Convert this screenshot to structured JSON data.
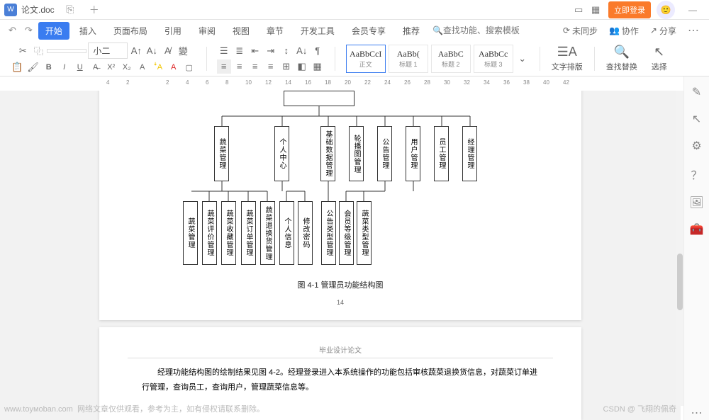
{
  "titlebar": {
    "filename": "论文.doc",
    "login": "立即登录",
    "avatar": "Hi"
  },
  "menubar": {
    "undo1": "↶",
    "redo": "↷",
    "items": [
      "开始",
      "插入",
      "页面布局",
      "引用",
      "审阅",
      "视图",
      "章节",
      "开发工具",
      "会员专享",
      "推荐"
    ],
    "search_placeholder": "查找功能、搜索模板",
    "right": {
      "sync": "未同步",
      "collab": "协作",
      "share": "分享"
    }
  },
  "ribbon": {
    "font_name": "",
    "font_size": "小二",
    "styles": [
      {
        "prev": "AaBbCcI",
        "name": "正文"
      },
      {
        "prev": "AaBb(",
        "name": "标题 1"
      },
      {
        "prev": "AaBbC",
        "name": "标题 2"
      },
      {
        "prev": "AaBbCc",
        "name": "标题 3"
      }
    ],
    "layout_btn": "文字排版",
    "find_btn": "查找替换",
    "select_btn": "选择"
  },
  "ruler_ticks": [
    "4",
    "2",
    "",
    "2",
    "4",
    "6",
    "8",
    "10",
    "12",
    "14",
    "16",
    "18",
    "20",
    "22",
    "24",
    "26",
    "28",
    "30",
    "32",
    "34",
    "36",
    "38",
    "40",
    "42"
  ],
  "doc": {
    "root": "",
    "mid": [
      "蔬菜管理",
      "个人中心",
      "基础数据管理",
      "轮播图管理",
      "公告管理",
      "用户管理",
      "员工管理",
      "经理管理"
    ],
    "leaf": [
      "蔬菜管理",
      "蔬菜评价管理",
      "蔬菜收藏管理",
      "蔬菜订单管理",
      "蔬菜退换货管理",
      "个人信息",
      "修改密码",
      "公告类型管理",
      "会员等级管理",
      "蔬菜类型管理"
    ],
    "caption": "图 4-1 管理员功能结构图",
    "pagenum": "14",
    "page2_header": "毕业设计论文",
    "page2_body": "经理功能结构图的绘制结果见图 4-2。经理登录进入本系统操作的功能包括审核蔬菜退换货信息，对蔬菜订单进行管理，查询员工，查询用户，管理蔬菜信息等。"
  },
  "watermark": {
    "left_a": "www.toyмоban.com",
    "left_b": "网络文章仅供观看，参考为主，如有侵权请联系删除。",
    "right": "CSDN @ 飞翔的佩奇"
  }
}
